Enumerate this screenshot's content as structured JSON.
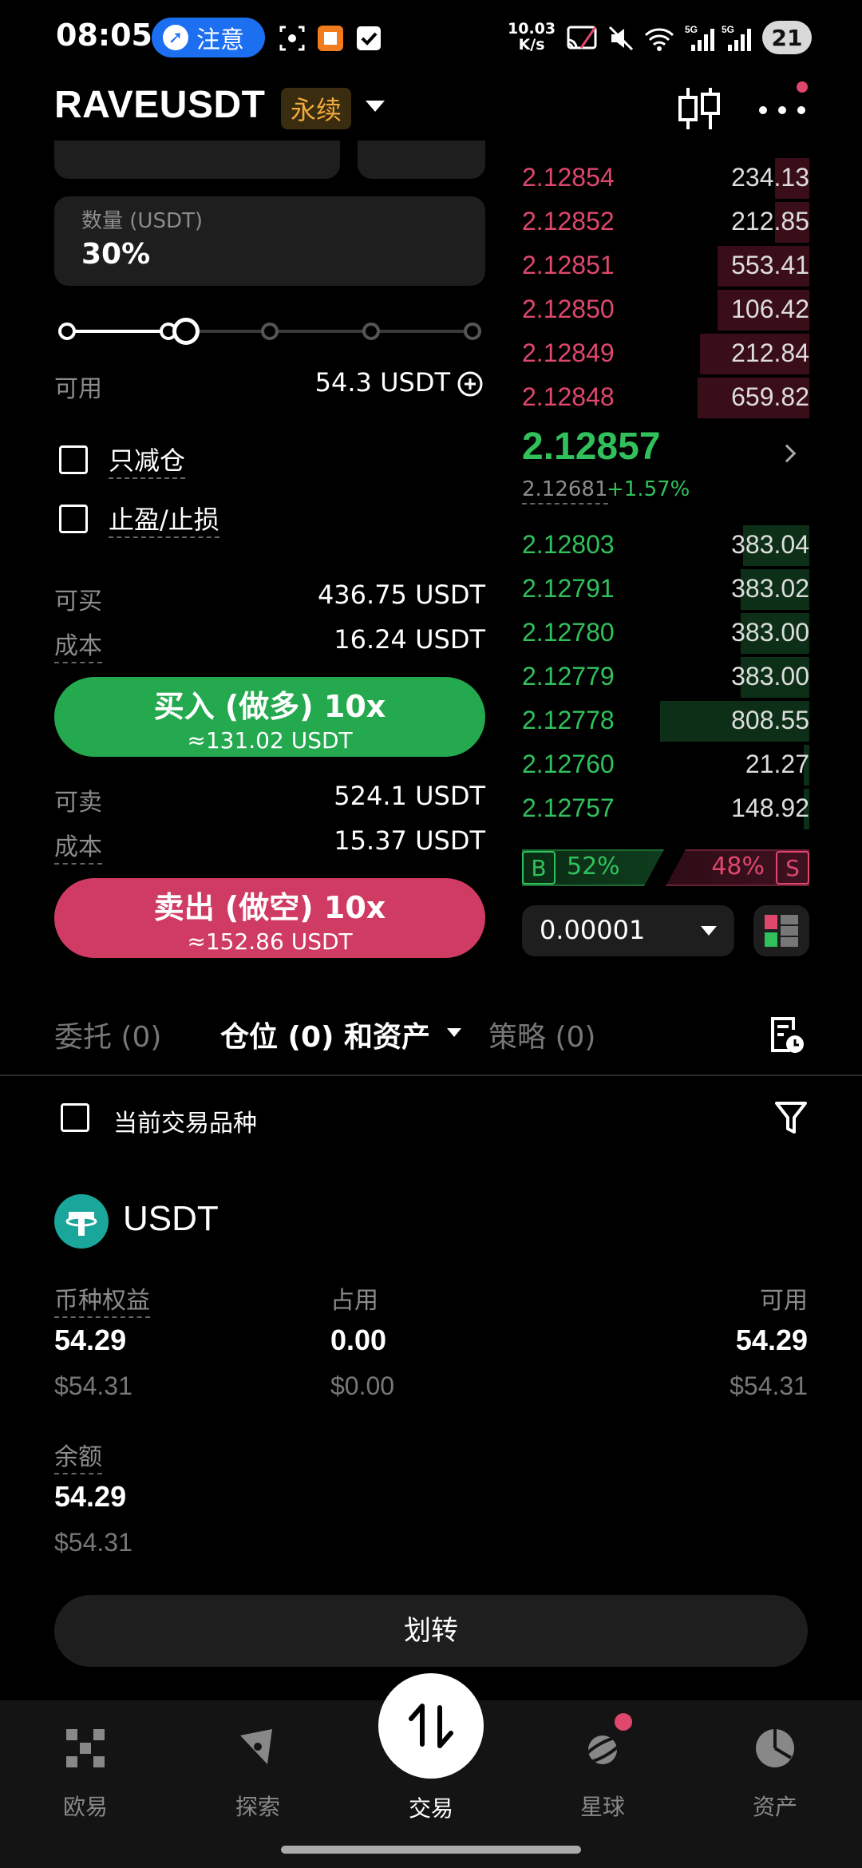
{
  "status_bar": {
    "time": "08:05",
    "notice": "注意",
    "speed_value": "10.03",
    "speed_unit": "K/s",
    "net1": "5G",
    "net2": "5G",
    "battery": "21"
  },
  "header": {
    "pair": "RAVEUSDT",
    "contract_type": "永续"
  },
  "form": {
    "quantity_label": "数量 (USDT)",
    "quantity_value": "30%",
    "slider_fraction": 0.3,
    "available_label": "可用",
    "available_value": "54.3 USDT",
    "reduce_only": "只减仓",
    "tp_sl": "止盈/止损",
    "can_buy_label": "可买",
    "can_buy_value": "436.75 USDT",
    "cost_label": "成本",
    "buy_cost": "16.24 USDT",
    "buy_button": "买入 (做多) 10x",
    "buy_button_sub": "≈131.02 USDT",
    "can_sell_label": "可卖",
    "can_sell_value": "524.1 USDT",
    "sell_cost": "15.37 USDT",
    "sell_button": "卖出 (做空) 10x",
    "sell_button_sub": "≈152.86 USDT"
  },
  "orderbook": {
    "asks": [
      {
        "price": "2.12854",
        "qty": "234.13",
        "depth": 0.12
      },
      {
        "price": "2.12852",
        "qty": "212.85",
        "depth": 0.12
      },
      {
        "price": "2.12851",
        "qty": "553.41",
        "depth": 0.32
      },
      {
        "price": "2.12850",
        "qty": "106.42",
        "depth": 0.32
      },
      {
        "price": "2.12849",
        "qty": "212.84",
        "depth": 0.38
      },
      {
        "price": "2.12848",
        "qty": "659.82",
        "depth": 0.39
      }
    ],
    "last_price": "2.12857",
    "mark_price": "2.12681",
    "change": "+1.57%",
    "bids": [
      {
        "price": "2.12803",
        "qty": "383.04",
        "depth": 0.23
      },
      {
        "price": "2.12791",
        "qty": "383.02",
        "depth": 0.24
      },
      {
        "price": "2.12780",
        "qty": "383.00",
        "depth": 0.24
      },
      {
        "price": "2.12779",
        "qty": "383.00",
        "depth": 0.24
      },
      {
        "price": "2.12778",
        "qty": "808.55",
        "depth": 0.52
      },
      {
        "price": "2.12760",
        "qty": "21.27",
        "depth": 0.02
      },
      {
        "price": "2.12757",
        "qty": "148.92",
        "depth": 0.02
      }
    ],
    "buy_tag": "B",
    "buy_pct": "52%",
    "sell_pct": "48%",
    "sell_tag": "S",
    "precision": "0.00001"
  },
  "tabs": {
    "orders": "委托 (0)",
    "positions": "仓位 (0) 和资产",
    "strategy": "策略 (0)"
  },
  "filter": {
    "current_only": "当前交易品种"
  },
  "asset": {
    "name": "USDT",
    "equity_label": "币种权益",
    "equity": "54.29",
    "equity_usd": "$54.31",
    "used_label": "占用",
    "used": "0.00",
    "used_usd": "$0.00",
    "available_label": "可用",
    "available": "54.29",
    "available_usd": "$54.31",
    "balance_label": "余额",
    "balance": "54.29",
    "balance_usd": "$54.31",
    "transfer": "划转"
  },
  "nav": {
    "home": "欧易",
    "discover": "探索",
    "trade": "交易",
    "planet": "星球",
    "assets": "资产"
  },
  "colors": {
    "buy": "#25a94f",
    "sell": "#cf3b62",
    "up": "#30c15c",
    "down": "#e0476c"
  }
}
